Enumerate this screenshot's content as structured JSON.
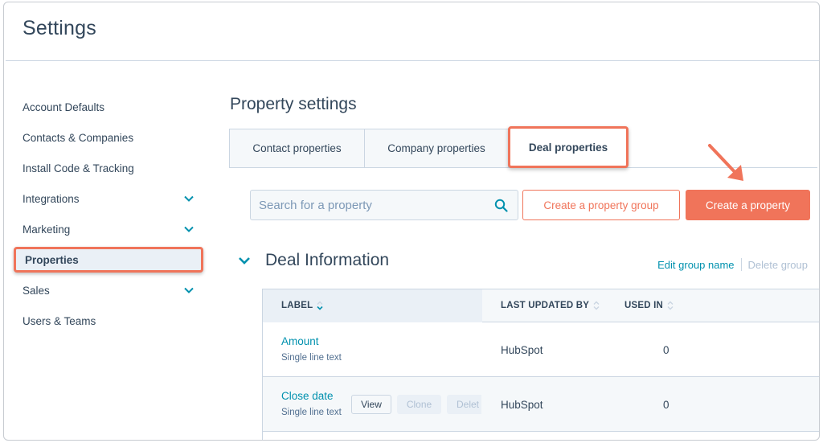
{
  "header": {
    "title": "Settings"
  },
  "sidebar": {
    "items": [
      {
        "label": "Account Defaults",
        "has_chevron": false
      },
      {
        "label": "Contacts & Companies",
        "has_chevron": false
      },
      {
        "label": "Install Code & Tracking",
        "has_chevron": false
      },
      {
        "label": "Integrations",
        "has_chevron": true
      },
      {
        "label": "Marketing",
        "has_chevron": true
      },
      {
        "label": "Properties",
        "has_chevron": false,
        "active": true
      },
      {
        "label": "Sales",
        "has_chevron": true
      },
      {
        "label": "Users & Teams",
        "has_chevron": false
      }
    ]
  },
  "main": {
    "title": "Property settings",
    "tabs": [
      {
        "label": "Contact properties"
      },
      {
        "label": "Company properties"
      },
      {
        "label": "Deal properties",
        "selected": true
      }
    ],
    "search": {
      "placeholder": "Search for a property",
      "value": ""
    },
    "buttons": {
      "create_group": "Create a property group",
      "create_property": "Create a property"
    },
    "group": {
      "title": "Deal Information",
      "edit_label": "Edit group name",
      "delete_label": "Delete group"
    },
    "table": {
      "columns": [
        "LABEL",
        "LAST UPDATED BY",
        "USED IN"
      ],
      "rows": [
        {
          "label": "Amount",
          "type": "Single line text",
          "updated_by": "HubSpot",
          "used_in": "0"
        },
        {
          "label": "Close date",
          "type": "Single line text",
          "updated_by": "HubSpot",
          "used_in": "0"
        }
      ],
      "row_actions": {
        "view": "View",
        "clone": "Clone",
        "delete": "Delet"
      }
    }
  },
  "colors": {
    "accent": "#f0745a",
    "link": "#0091ae",
    "text": "#33475b",
    "border": "#cbd6e2",
    "muted_bg": "#f5f8fa"
  }
}
